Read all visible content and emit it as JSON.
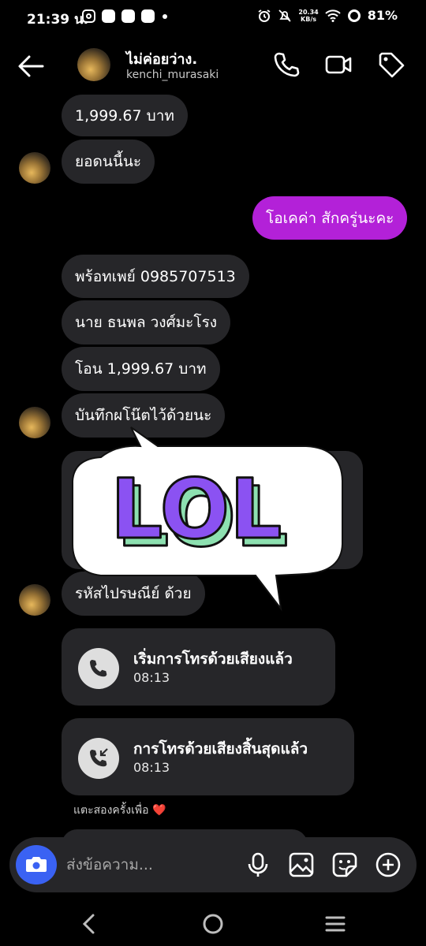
{
  "status_bar": {
    "time": "21:39 น.",
    "net_speed_value": "20.34",
    "net_speed_unit": "KB/s",
    "battery": "81%"
  },
  "header": {
    "name": "ไม่ค่อยว่าง.",
    "username": "kenchi_murasaki"
  },
  "messages": [
    {
      "text": "1,999.67 บาท",
      "direction": "in"
    },
    {
      "text": "ยอดนนี้นะ",
      "direction": "in"
    },
    {
      "text": "โอเคค่า สักครู่นะคะ",
      "direction": "out"
    },
    {
      "text": "พร้อทเพย์ 0985707513",
      "direction": "in"
    },
    {
      "text": "นาย ธนพล วงศ์มะโรง",
      "direction": "in"
    },
    {
      "text": "โอน 1,999.67 บาท",
      "direction": "in"
    },
    {
      "text": "บันทึกผโน๊ตไว้ด้วยนะ",
      "direction": "in"
    },
    {
      "text": "รหัสไปรษณีย์ ด้วย",
      "direction": "in"
    }
  ],
  "calls": [
    {
      "title": "เริ่มการโทรด้วยเสียงแล้ว",
      "time": "08:13",
      "icon": "phone-icon"
    },
    {
      "title": "การโทรด้วยเสียงสิ้นสุดแล้ว",
      "time": "08:13",
      "icon": "phone-ended-icon"
    }
  ],
  "sticker": {
    "text": "LOL"
  },
  "hint": {
    "text": "แตะสองครั้งเพื่อ",
    "emoji": "❤️"
  },
  "composer": {
    "placeholder": "ส่งข้อความ..."
  },
  "colors": {
    "background": "#000000",
    "incoming_bubble": "#262629",
    "outgoing_bubble": "#b321d8",
    "camera_button": "#3a62f3",
    "sticker_purple": "#8b52f2",
    "sticker_green": "#8de0b0"
  }
}
